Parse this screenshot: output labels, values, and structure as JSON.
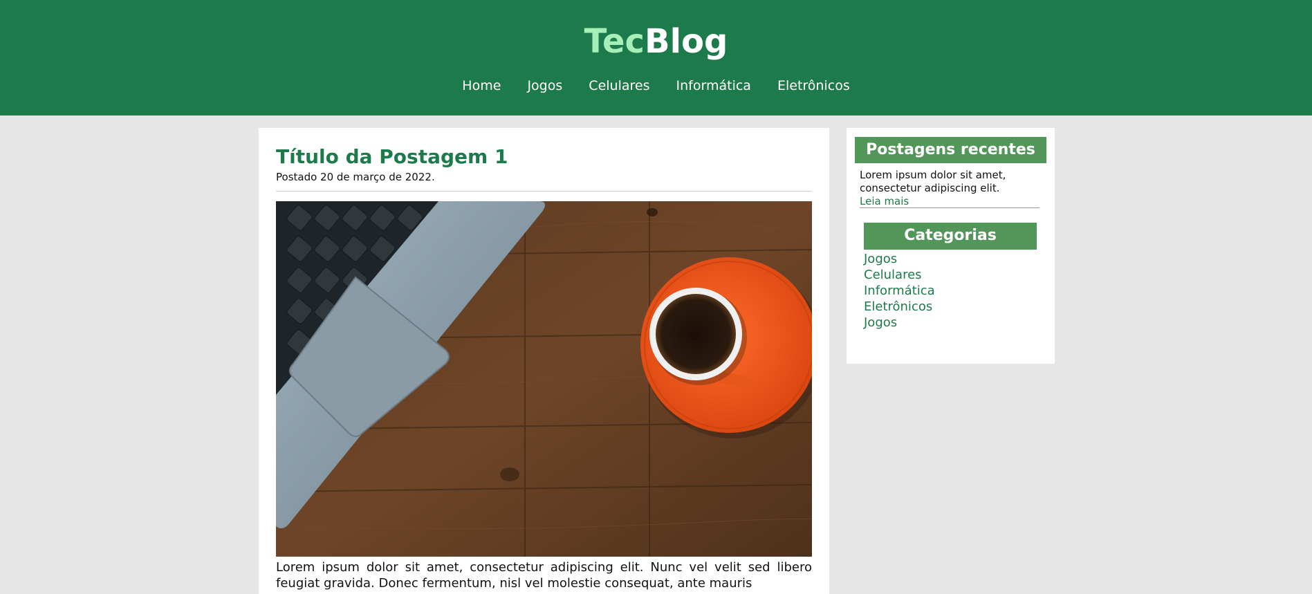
{
  "header": {
    "logo_part1": "Tec",
    "logo_part2": "Blog",
    "nav": [
      "Home",
      "Jogos",
      "Celulares",
      "Informática",
      "Eletrônicos"
    ]
  },
  "post": {
    "title": "Título da Postagem 1",
    "date": "Postado 20 de março de 2022.",
    "image": "laptop-and-coffee-cup-photo",
    "text": "Lorem ipsum dolor sit amet, consectetur adipiscing elit. Nunc vel velit sed libero feugiat gravida. Donec fermentum, nisl vel molestie consequat, ante mauris"
  },
  "sidebar": {
    "recent": {
      "title": "Postagens recentes",
      "text": "Lorem ipsum dolor sit amet, consectetur adipiscing elit.",
      "link": "Leia mais"
    },
    "categories": {
      "title": "Categorias",
      "items": [
        "Jogos",
        "Celulares",
        "Informática",
        "Eletrônicos",
        "Jogos"
      ]
    }
  },
  "colors": {
    "brand_green": "#1d7a4a",
    "widget_green": "#52965a",
    "logo_accent": "#a7efb8",
    "page_background": "#e6e6e6"
  }
}
